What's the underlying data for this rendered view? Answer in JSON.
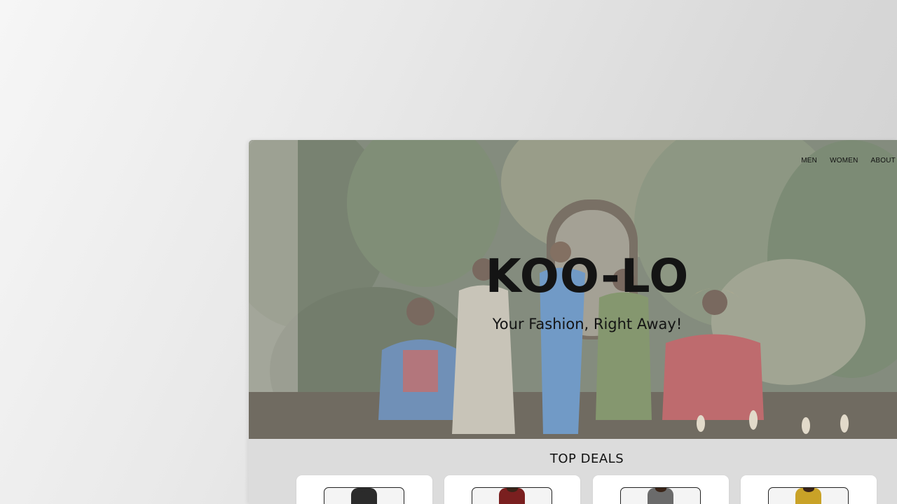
{
  "nav": {
    "items": [
      "MEN",
      "WOMEN",
      "ABOUT"
    ]
  },
  "hero": {
    "brand": "KOO-LO",
    "tagline": "Your Fashion, Right Away!"
  },
  "deals": {
    "title": "TOP DEALS",
    "cards": [
      {
        "thumb_color": "#2b2b2b"
      },
      {
        "thumb_color": "#7a1f1f"
      },
      {
        "thumb_color": "#6b6b6b"
      },
      {
        "thumb_color": "#c9a227"
      }
    ]
  }
}
